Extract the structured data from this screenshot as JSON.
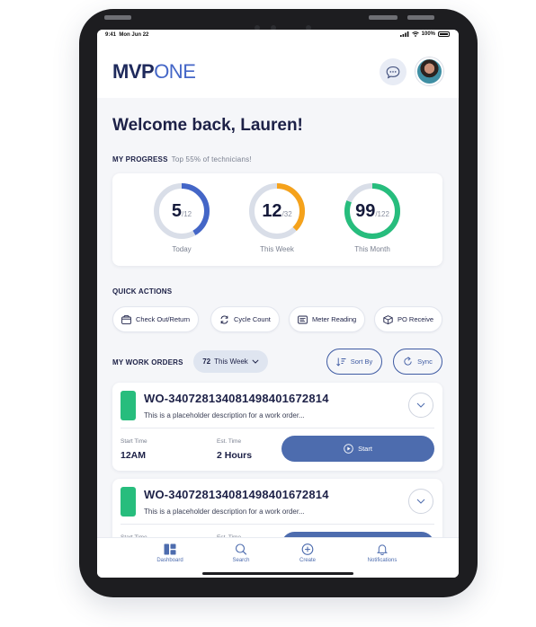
{
  "status_bar": {
    "time": "9:41",
    "date": "Mon Jun 22",
    "battery": "100%"
  },
  "header": {
    "logo_main": "MVP",
    "logo_accent": "ONE",
    "chat_icon": "chat-bubble-icon",
    "avatar_icon": "user-avatar"
  },
  "welcome": "Welcome back, Lauren!",
  "progress": {
    "label": "MY PROGRESS",
    "sublabel": "Top 55% of technicians!",
    "rings": [
      {
        "value": "5",
        "total": "/12",
        "label": "Today",
        "fraction": 0.4167,
        "color": "#4466c7"
      },
      {
        "value": "12",
        "total": "/32",
        "label": "This Week",
        "fraction": 0.375,
        "color": "#f5a21b"
      },
      {
        "value": "99",
        "total": "/122",
        "label": "This Month",
        "fraction": 0.8115,
        "color": "#27bd7d"
      }
    ],
    "track_color": "#d9dee8"
  },
  "quick_actions": {
    "label": "QUICK ACTIONS",
    "items": [
      {
        "label": "Check Out/Return",
        "icon": "tray-icon"
      },
      {
        "label": "Cycle Count",
        "icon": "cycle-icon"
      },
      {
        "label": "Meter Reading",
        "icon": "meter-icon"
      },
      {
        "label": "PO Receive",
        "icon": "package-icon"
      }
    ]
  },
  "work_orders": {
    "label": "MY WORK ORDERS",
    "filter_count": "72",
    "filter_label": "This Week",
    "sort_label": "Sort By",
    "sync_label": "Sync",
    "cards": [
      {
        "id": "WO-34072813408149840167281​4",
        "description": "This is a placeholder description for a work order...",
        "start_time_label": "Start Time",
        "start_time": "12AM",
        "est_time_label": "Est. Time",
        "est_time": "2 Hours",
        "action_label": "Start",
        "status_color": "#27bd7d"
      },
      {
        "id": "WO-34072813408149840167281​4",
        "description": "This is a placeholder description for a work order...",
        "start_time_label": "Start Time",
        "start_time": "",
        "est_time_label": "Est. Time",
        "est_time": "",
        "action_label": "",
        "status_color": "#27bd7d"
      }
    ]
  },
  "tabbar": {
    "items": [
      {
        "label": "Dashboard",
        "icon": "dashboard-icon"
      },
      {
        "label": "Search",
        "icon": "search-icon"
      },
      {
        "label": "Create",
        "icon": "plus-circle-icon"
      },
      {
        "label": "Notifications",
        "icon": "bell-icon"
      }
    ]
  },
  "colors": {
    "brand_dark": "#1f2a5c",
    "brand_blue": "#4466c7",
    "button_blue": "#4d6cae",
    "status_green": "#27bd7d"
  }
}
